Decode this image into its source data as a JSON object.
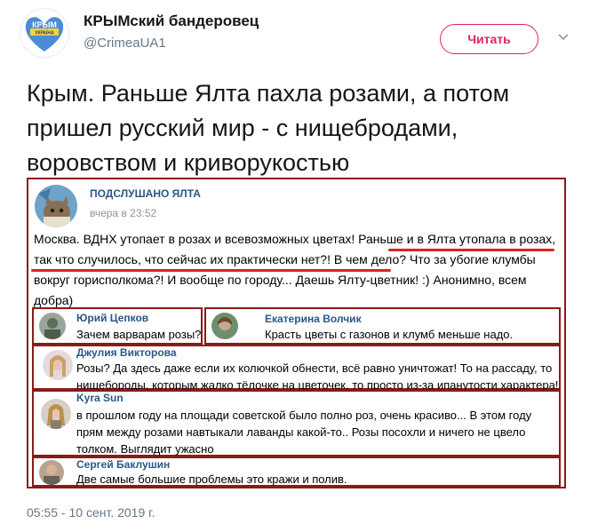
{
  "author": {
    "name": "КРЫМский бандеровец",
    "handle": "@CrimeaUA1",
    "avatar_text_top": "КРЫМ",
    "avatar_text_bottom": "УКРАЇНА"
  },
  "follow_label": "Читать",
  "tweet_text": "Крым. Раньше Ялта пахла розами, а потом пришел русский мир - с нищебродами, воровством и криворукостью",
  "post": {
    "group_name": "ПОДСЛУШАНО ЯЛТА",
    "time": "вчера в 23:52",
    "text": "Москва. ВДНХ утопает в розах и всевозможных цветах! Раньше и в Ялта утопала в розах, так что случилось, что сейчас их практически нет?! В чем дело? Что за убогие клумбы вокруг горисполкома?! И вообще по городу... Даешь Ялту-цветник! :) Анонимно, всем добра)"
  },
  "comments": [
    {
      "name": "Юрий Цепков",
      "text": "Зачем варварам розы?"
    },
    {
      "name": "Екатерина Волчик",
      "text": "Красть цветы с газонов и клумб меньше надо."
    },
    {
      "name": "Джулия Викторова",
      "text": "Розы? Да здесь даже если их колючкой обнести, всё равно уничтожат! То на рассаду, то нищебороды, которым жалко тёлочке на цветочек, то просто из-за ипанутости характера!"
    },
    {
      "name": "Kyra Sun",
      "text": "в прошлом году на площади советской было полно роз, очень красиво... В этом году прям между розами навтыкали лаванды какой-то.. Розы посохли и ничего не цвело толком. Выглядит ужасно"
    },
    {
      "name": "Сергей Баклушин",
      "text": "Две самые большие проблемы это кражи и полив."
    }
  ],
  "timestamp": "05:55 - 10 сент. 2019 г.",
  "colors": {
    "accent": "#e0245e",
    "frame": "#8b1a1a",
    "highlight": "#e02020",
    "link": "#2a5885"
  }
}
